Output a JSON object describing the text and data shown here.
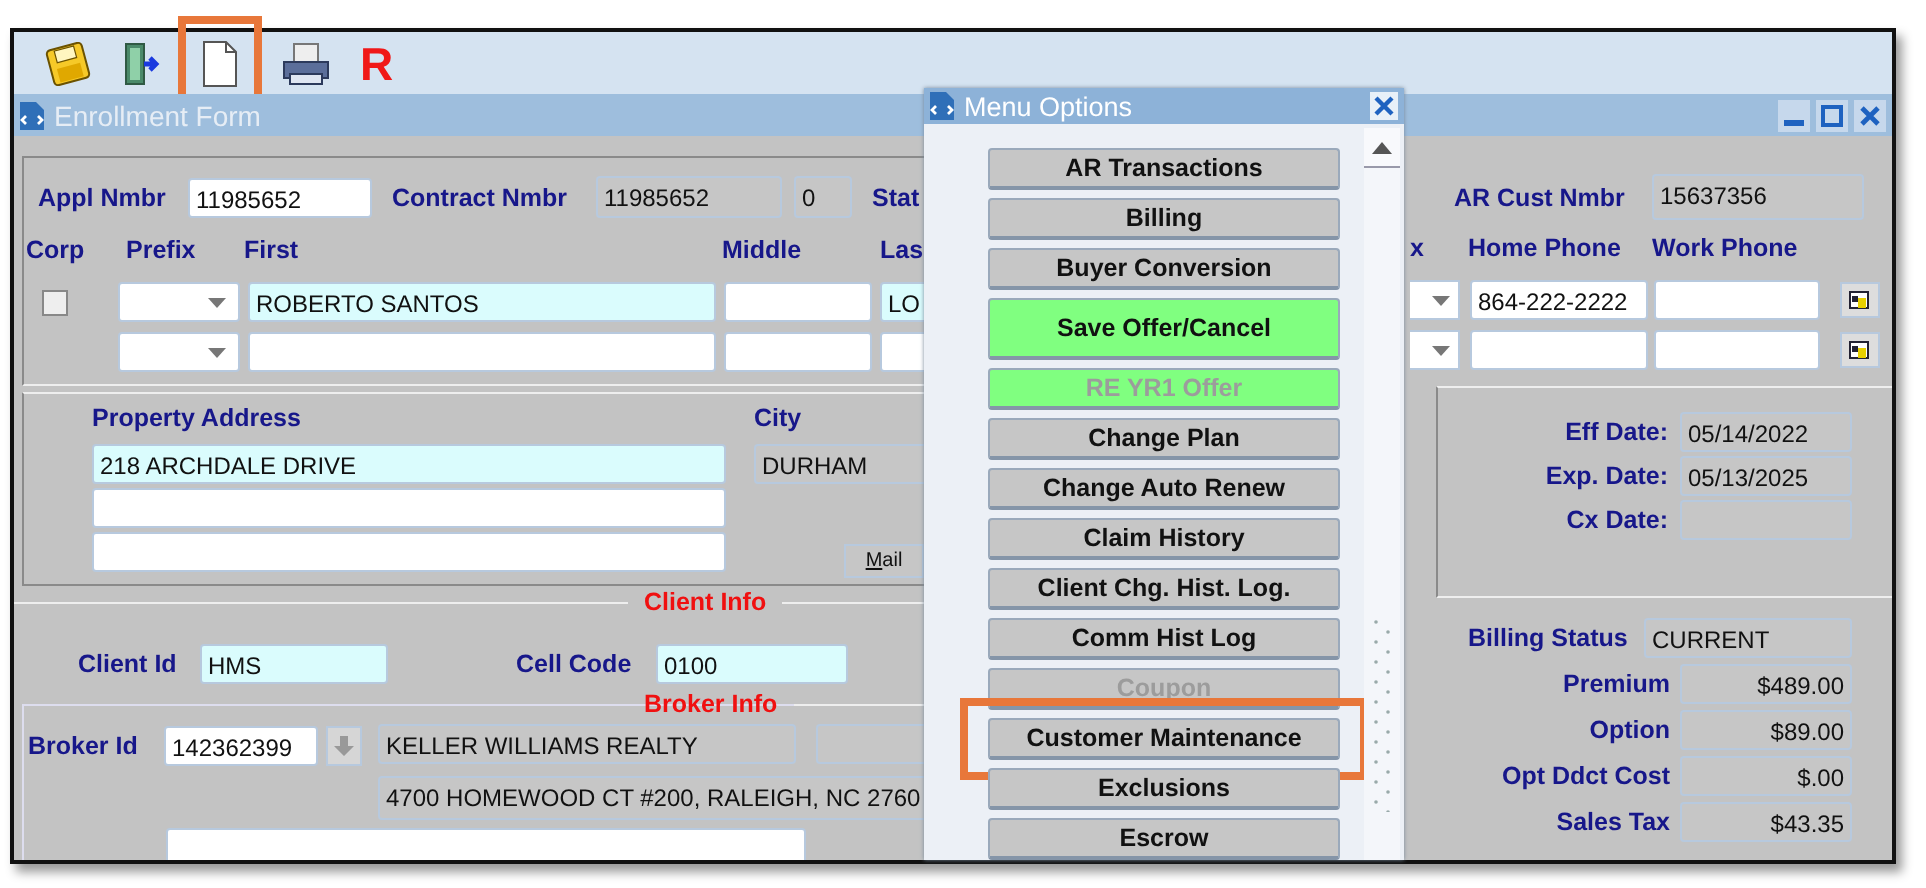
{
  "toolbar": {
    "icons": [
      {
        "kind": "save",
        "highlighted": false
      },
      {
        "kind": "exit",
        "highlighted": false
      },
      {
        "kind": "new",
        "highlighted": true
      },
      {
        "kind": "print",
        "highlighted": false
      },
      {
        "kind": "letter",
        "text": "R",
        "highlighted": false
      }
    ]
  },
  "enrollment_form": {
    "title": "Enrollment Form",
    "header": {
      "appl_label": "Appl Nmbr",
      "appl_value": "11985652",
      "contract_label": "Contract Nmbr",
      "contract_value": "11985652",
      "contract_suffix": "0",
      "status_label": "Stat",
      "ar_label": "AR Cust Nmbr",
      "ar_value": "15637356"
    },
    "name_columns": [
      "Corp",
      "Prefix",
      "First",
      "Middle",
      "Las"
    ],
    "phone_columns": [
      "x",
      "Home Phone",
      "Work Phone"
    ],
    "name_rows": [
      {
        "corp_checked": false,
        "first": "ROBERTO SANTOS",
        "last": "LO",
        "home_phone": "864-222-2222"
      },
      {}
    ],
    "property": {
      "address_label": "Property Address",
      "address_lines": [
        "218 ARCHDALE DRIVE"
      ],
      "city_label": "City",
      "city": "DURHAM",
      "mail_button": "Mail"
    },
    "client_info": {
      "heading": "Client Info",
      "client_id_label": "Client Id",
      "client_id": "HMS",
      "cell_code_label": "Cell Code",
      "cell_code": "0100"
    },
    "broker_info": {
      "heading": "Broker Info",
      "broker_id_label": "Broker Id",
      "broker_id": "142362399",
      "broker_name": "KELLER WILLIAMS REALTY",
      "broker_address": "4700 HOMEWOOD CT #200, RALEIGH, NC 2760"
    },
    "dates": [
      {
        "label": "Eff Date:",
        "value": "05/14/2022"
      },
      {
        "label": "Exp. Date:",
        "value": "05/13/2025"
      },
      {
        "label": "Cx Date:"
      }
    ],
    "billing": {
      "status_label": "Billing Status",
      "status": "CURRENT",
      "amounts": [
        {
          "label": "Premium",
          "value": "$489.00"
        },
        {
          "label": "Option",
          "value": "$89.00"
        },
        {
          "label": "Opt Ddct Cost",
          "value": "$.00"
        },
        {
          "label": "Sales Tax",
          "value": "$43.35"
        }
      ]
    }
  },
  "menu_options": {
    "title": "Menu Options",
    "items": [
      {
        "label": "AR Transactions",
        "color": "#c6c6c6",
        "disabled": false,
        "highlighted": false
      },
      {
        "label": "Billing",
        "color": "#c6c6c6",
        "disabled": false,
        "highlighted": false
      },
      {
        "label": "Buyer Conversion",
        "color": "#c6c6c6",
        "disabled": false,
        "highlighted": false
      },
      {
        "label": "Save Offer/Cancel",
        "color": "#80ff80",
        "disabled": false,
        "highlighted": false
      },
      {
        "label": "RE YR1 Offer",
        "color": "#80ff80",
        "disabled": true,
        "highlighted": false
      },
      {
        "label": "Change Plan",
        "color": "#c6c6c6",
        "disabled": false,
        "highlighted": false
      },
      {
        "label": "Change Auto Renew",
        "color": "#c6c6c6",
        "disabled": false,
        "highlighted": false
      },
      {
        "label": "Claim History",
        "color": "#c6c6c6",
        "disabled": false,
        "highlighted": false
      },
      {
        "label": "Client Chg. Hist. Log.",
        "color": "#c6c6c6",
        "disabled": false,
        "highlighted": false
      },
      {
        "label": "Comm Hist Log",
        "color": "#c6c6c6",
        "disabled": false,
        "highlighted": false
      },
      {
        "label": "Coupon",
        "color": "#c6c6c6",
        "disabled": true,
        "highlighted": false
      },
      {
        "label": "Customer Maintenance",
        "color": "#c6c6c6",
        "disabled": false,
        "highlighted": true
      },
      {
        "label": "Exclusions",
        "color": "#c6c6c6",
        "disabled": false,
        "highlighted": false
      },
      {
        "label": "Escrow",
        "color": "#c6c6c6",
        "disabled": false,
        "highlighted": false
      }
    ]
  }
}
